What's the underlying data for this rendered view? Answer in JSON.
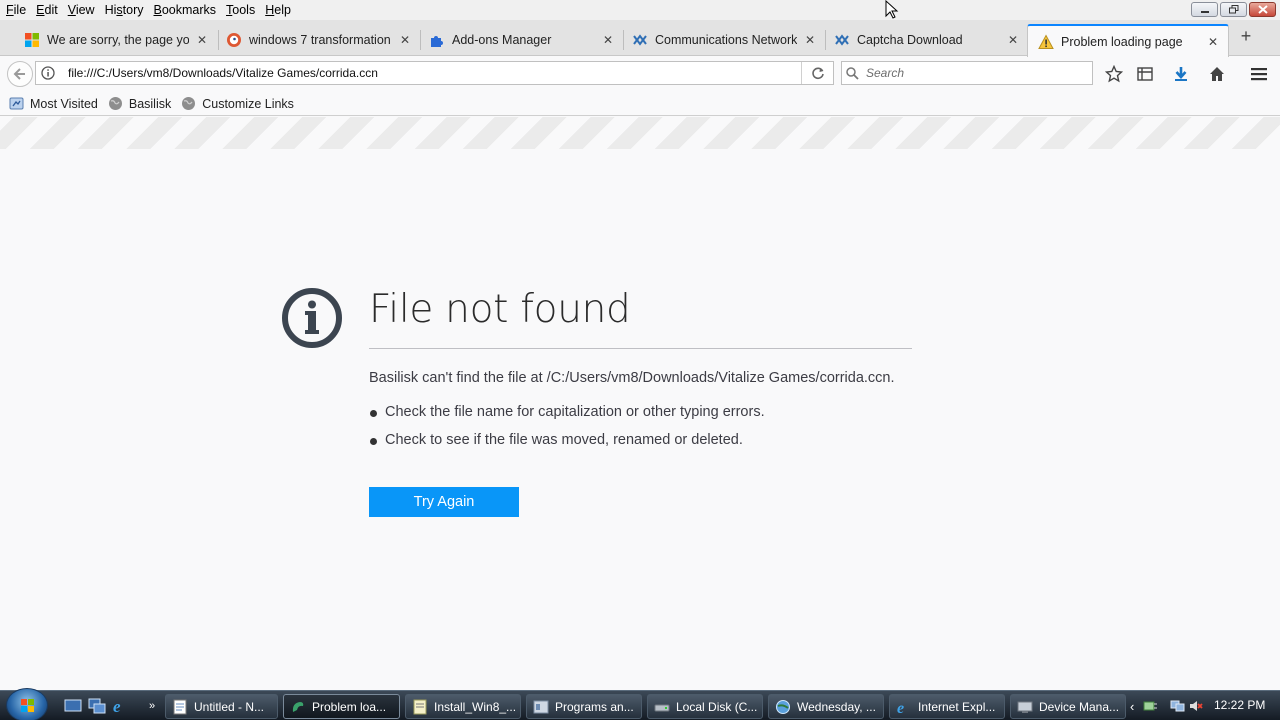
{
  "menubar": {
    "items": [
      "File",
      "Edit",
      "View",
      "History",
      "Bookmarks",
      "Tools",
      "Help"
    ],
    "underline": [
      "F",
      "E",
      "V",
      "s",
      "B",
      "T",
      "H"
    ]
  },
  "tabs": [
    {
      "title": "We are sorry, the page you",
      "icon": "windows-flag-icon"
    },
    {
      "title": "windows 7 transformation",
      "icon": "duckduckgo-icon"
    },
    {
      "title": "Add-ons Manager",
      "icon": "puzzle-icon"
    },
    {
      "title": "Communications Network",
      "icon": "network-icon"
    },
    {
      "title": "Captcha Download",
      "icon": "network-icon"
    },
    {
      "title": "Problem loading page",
      "icon": "warning-icon",
      "active": true
    }
  ],
  "navbar": {
    "url": "file:///C:/Users/vm8/Downloads/Vitalize Games/corrida.ccn",
    "search_placeholder": "Search"
  },
  "bookmarks": [
    {
      "label": "Most Visited",
      "icon": "bookmark-folder-icon"
    },
    {
      "label": "Basilisk",
      "icon": "globe-icon"
    },
    {
      "label": "Customize Links",
      "icon": "globe-icon"
    }
  ],
  "error": {
    "title": "File not found",
    "description": "Basilisk can't find the file at /C:/Users/vm8/Downloads/Vitalize Games/corrida.ccn.",
    "suggestions": [
      "Check the file name for capitalization or other typing errors.",
      "Check to see if the file was moved, renamed or deleted."
    ],
    "button": "Try Again"
  },
  "taskbar": {
    "buttons": [
      {
        "label": "Untitled - N...",
        "icon": "notepad-icon"
      },
      {
        "label": "Problem loa...",
        "icon": "basilisk-icon",
        "active": true
      },
      {
        "label": "Install_Win8_...",
        "icon": "text-file-icon"
      },
      {
        "label": "Programs an...",
        "icon": "control-panel-icon"
      },
      {
        "label": "Local Disk (C...",
        "icon": "drive-icon"
      },
      {
        "label": "Wednesday, ...",
        "icon": "globe-icon"
      },
      {
        "label": "Internet Expl...",
        "icon": "ie-icon"
      },
      {
        "label": "Device Mana...",
        "icon": "device-manager-icon"
      }
    ],
    "clock": "12:22 PM"
  },
  "colors": {
    "accent": "#0a84ff",
    "button": "#0996f8",
    "error_icon": "#3c4550"
  }
}
